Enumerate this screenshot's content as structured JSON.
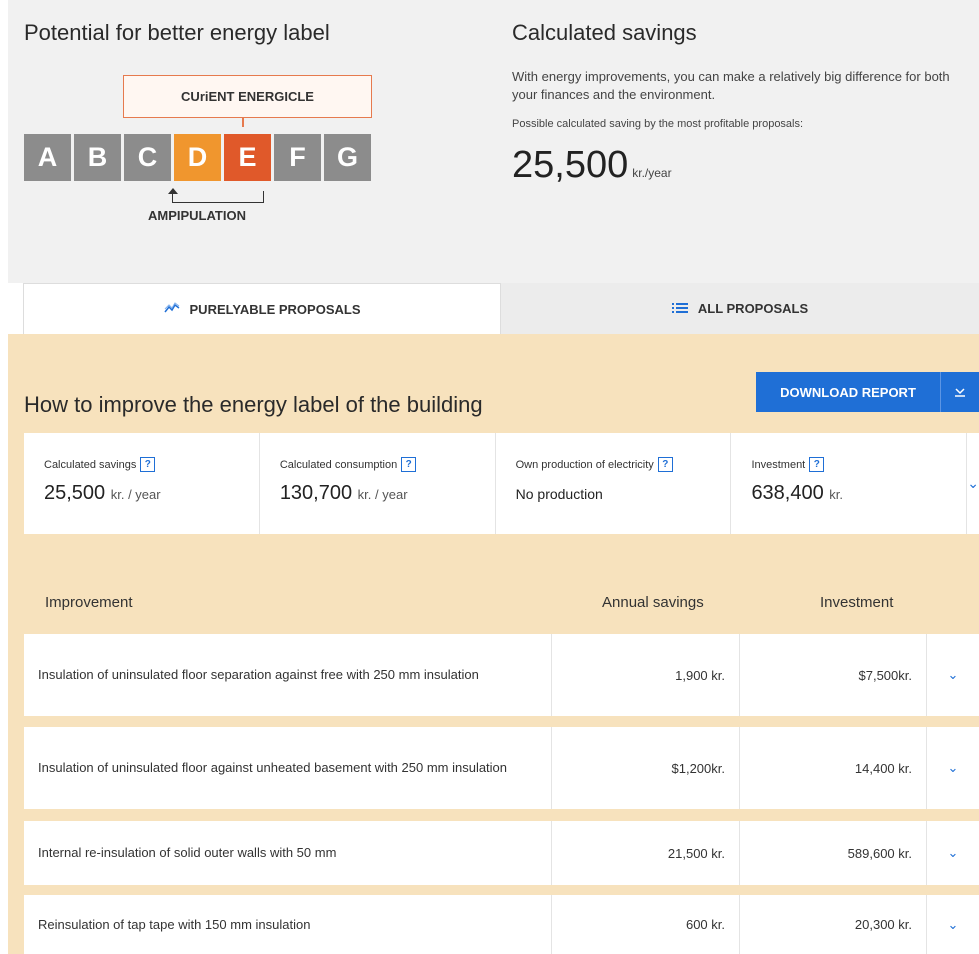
{
  "top_left": {
    "title": "Potential for better energy label",
    "current_label": "CUriENT ENERGICLE",
    "letters": [
      "A",
      "B",
      "C",
      "D",
      "E",
      "F",
      "G"
    ],
    "improvement_label": "AMPIPULATION"
  },
  "top_right": {
    "title": "Calculated savings",
    "description": "With energy improvements, you can make a relatively big difference for both your finances and the environment.",
    "sub_label": "Possible calculated saving by the most profitable proposals:",
    "value": "25,500",
    "unit": "kr./year"
  },
  "tabs": [
    {
      "label": "PURELYABLE PROPOSALS",
      "icon": "chart-icon"
    },
    {
      "label": "ALL PROPOSALS",
      "icon": "list-icon"
    }
  ],
  "main": {
    "heading": "How to improve the energy label of the building",
    "download_label": "DOWNLOAD REPORT",
    "download_caret": "⌄"
  },
  "stats": [
    {
      "label": "Calculated savings",
      "help": "?",
      "value": "25,500",
      "unit": "kr. / year"
    },
    {
      "label": "Calculated consumption",
      "help": "?",
      "value": "130,700",
      "unit": "kr. / year"
    },
    {
      "label": "Own production of electricity",
      "help": "?",
      "value": "No production",
      "unit": ""
    },
    {
      "label": "Investment",
      "help": "?",
      "value": "638,400",
      "unit": "kr."
    }
  ],
  "columns": {
    "improvement": "Improvement",
    "annual_savings": "Annual savings",
    "investment": "Investment"
  },
  "rows": [
    {
      "description": "Insulation of uninsulated floor separation against free with 250 mm insulation",
      "savings": "1,900 kr.",
      "investment": "$7,500kr."
    },
    {
      "description": "Insulation of uninsulated floor against unheated basement with 250 mm insulation",
      "savings": "$1,200kr.",
      "investment": "14,400 kr."
    },
    {
      "description": "Internal re-insulation of solid outer walls with 50 mm",
      "savings": "21,500 kr.",
      "investment": "589,600 kr."
    },
    {
      "description": "Reinsulation of tap tape with 150 mm insulation",
      "savings": "600 kr.",
      "investment": "20,300 kr."
    }
  ],
  "chevron": "⌄",
  "colors": {
    "accent": "#1f6fd6",
    "label_d": "#f0962e",
    "label_e": "#e0592a",
    "label_default": "#8c8c8c",
    "main_bg": "#f7e2bd"
  }
}
